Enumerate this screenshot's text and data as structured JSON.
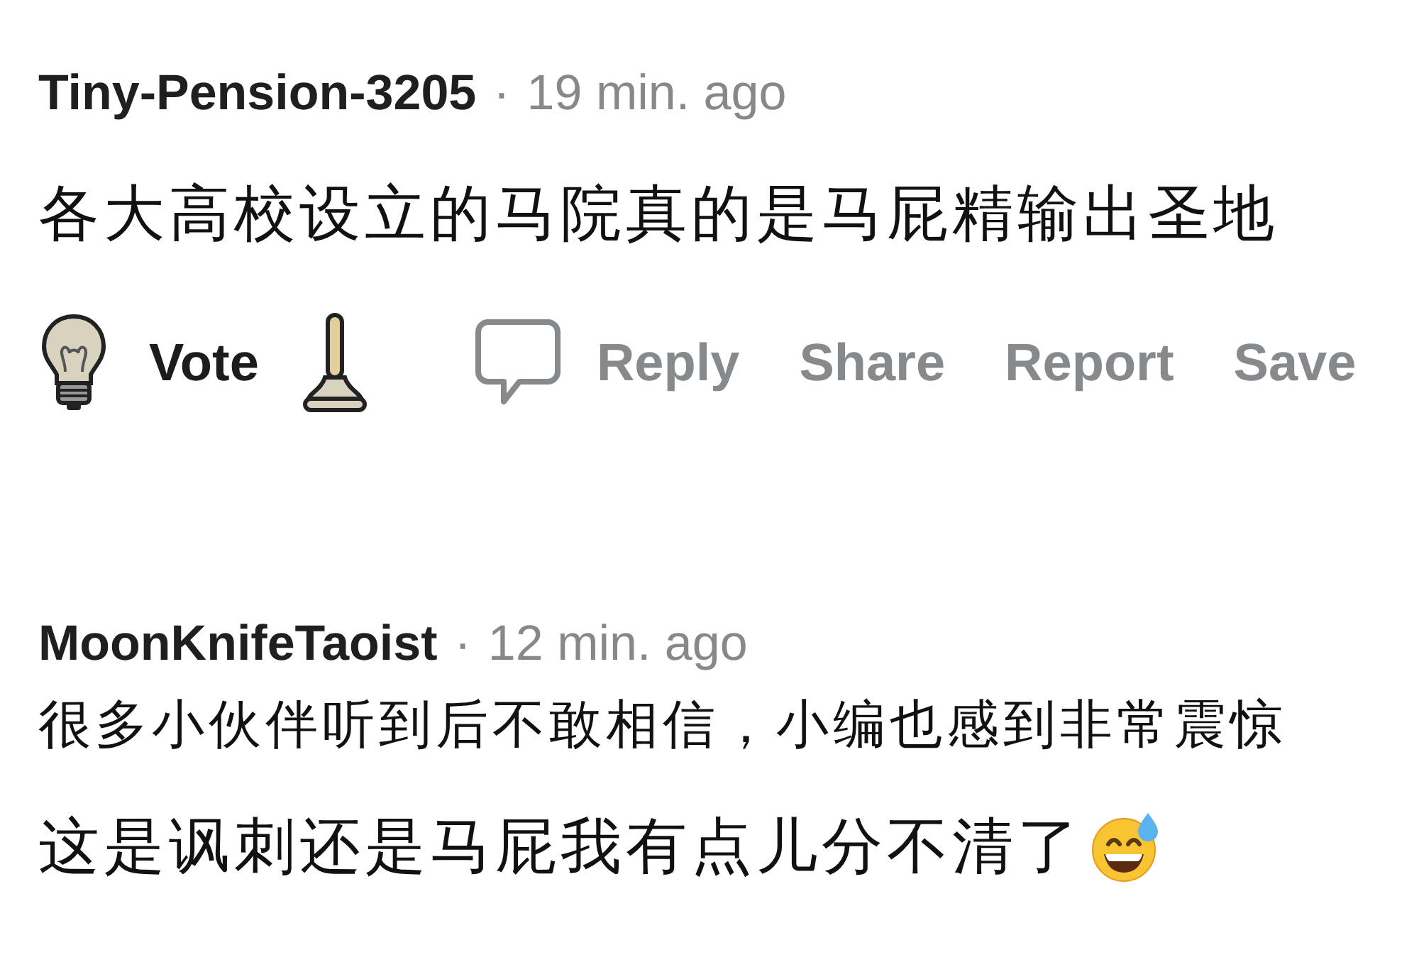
{
  "comments": [
    {
      "author": "Tiny-Pension-3205",
      "separator": "·",
      "time": "19 min. ago",
      "paragraphs": [
        {
          "text": "各大高校设立的马院真的是马屁精输出圣地",
          "trailing_emoji": false
        }
      ],
      "actions": {
        "vote": "Vote",
        "buttons": [
          {
            "label": "Reply",
            "kind": "reply"
          },
          {
            "label": "Share",
            "kind": "text"
          },
          {
            "label": "Report",
            "kind": "text"
          },
          {
            "label": "Save",
            "kind": "text"
          }
        ]
      }
    },
    {
      "author": "MoonKnifeTaoist",
      "separator": "·",
      "time": "12 min. ago",
      "paragraphs": [
        {
          "text": "很多小伙伴听到后不敢相信，小编也感到非常震惊",
          "trailing_emoji": false
        },
        {
          "text": "这是讽刺还是马屁我有点儿分不清了",
          "trailing_emoji": true
        }
      ]
    }
  ]
}
